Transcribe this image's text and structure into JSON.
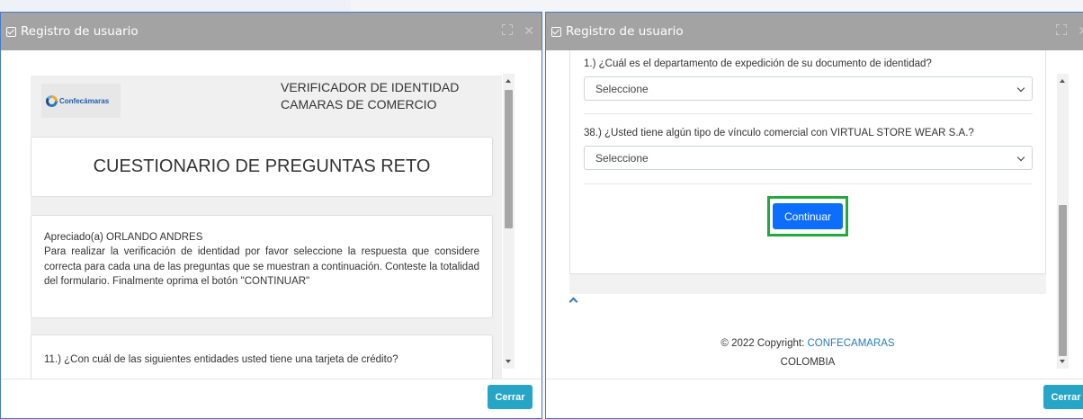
{
  "left_modal": {
    "title": "Registro de usuario",
    "logo_text": "Confecámaras",
    "verifier_line1": "VERIFICADOR DE IDENTIDAD",
    "verifier_line2": "CAMARAS DE COMERCIO",
    "questionnaire_title": "CUESTIONARIO DE PREGUNTAS RETO",
    "greeting": "Apreciado(a) ORLANDO ANDRES",
    "instructions": "Para realizar la verificación de identidad por favor seleccione la respuesta que considere correcta para cada una de las preguntas que se muestran a continuación. Conteste la totalidad del formulario. Finalmente oprima el botón \"CONTINUAR\"",
    "question_11": "11.) ¿Con cuál de las siguientes entidades usted tiene una tarjeta de crédito?",
    "close_label": "Cerrar",
    "scroll_position": 0
  },
  "right_modal": {
    "title": "Registro de usuario",
    "question_1": "1.) ¿Cuál es el departamento de expedición de su documento de identidad?",
    "select_1_value": "Seleccione",
    "question_38": "38.) ¿Usted tiene algún tipo de vínculo comercial con VIRTUAL STORE WEAR S.A.?",
    "select_38_value": "Seleccione",
    "continue_label": "Continuar",
    "copyright_prefix": "© 2022 Copyright: ",
    "copyright_link": "CONFECAMARAS",
    "country": "COLOMBIA",
    "close_label": "Cerrar",
    "scroll_position": 1
  },
  "colors": {
    "header_bg": "#a3a3a3",
    "close_button": "#26a5c6",
    "continue_button": "#0d6efd",
    "highlight_border": "#1faa3b",
    "link": "#2a7ab8"
  }
}
